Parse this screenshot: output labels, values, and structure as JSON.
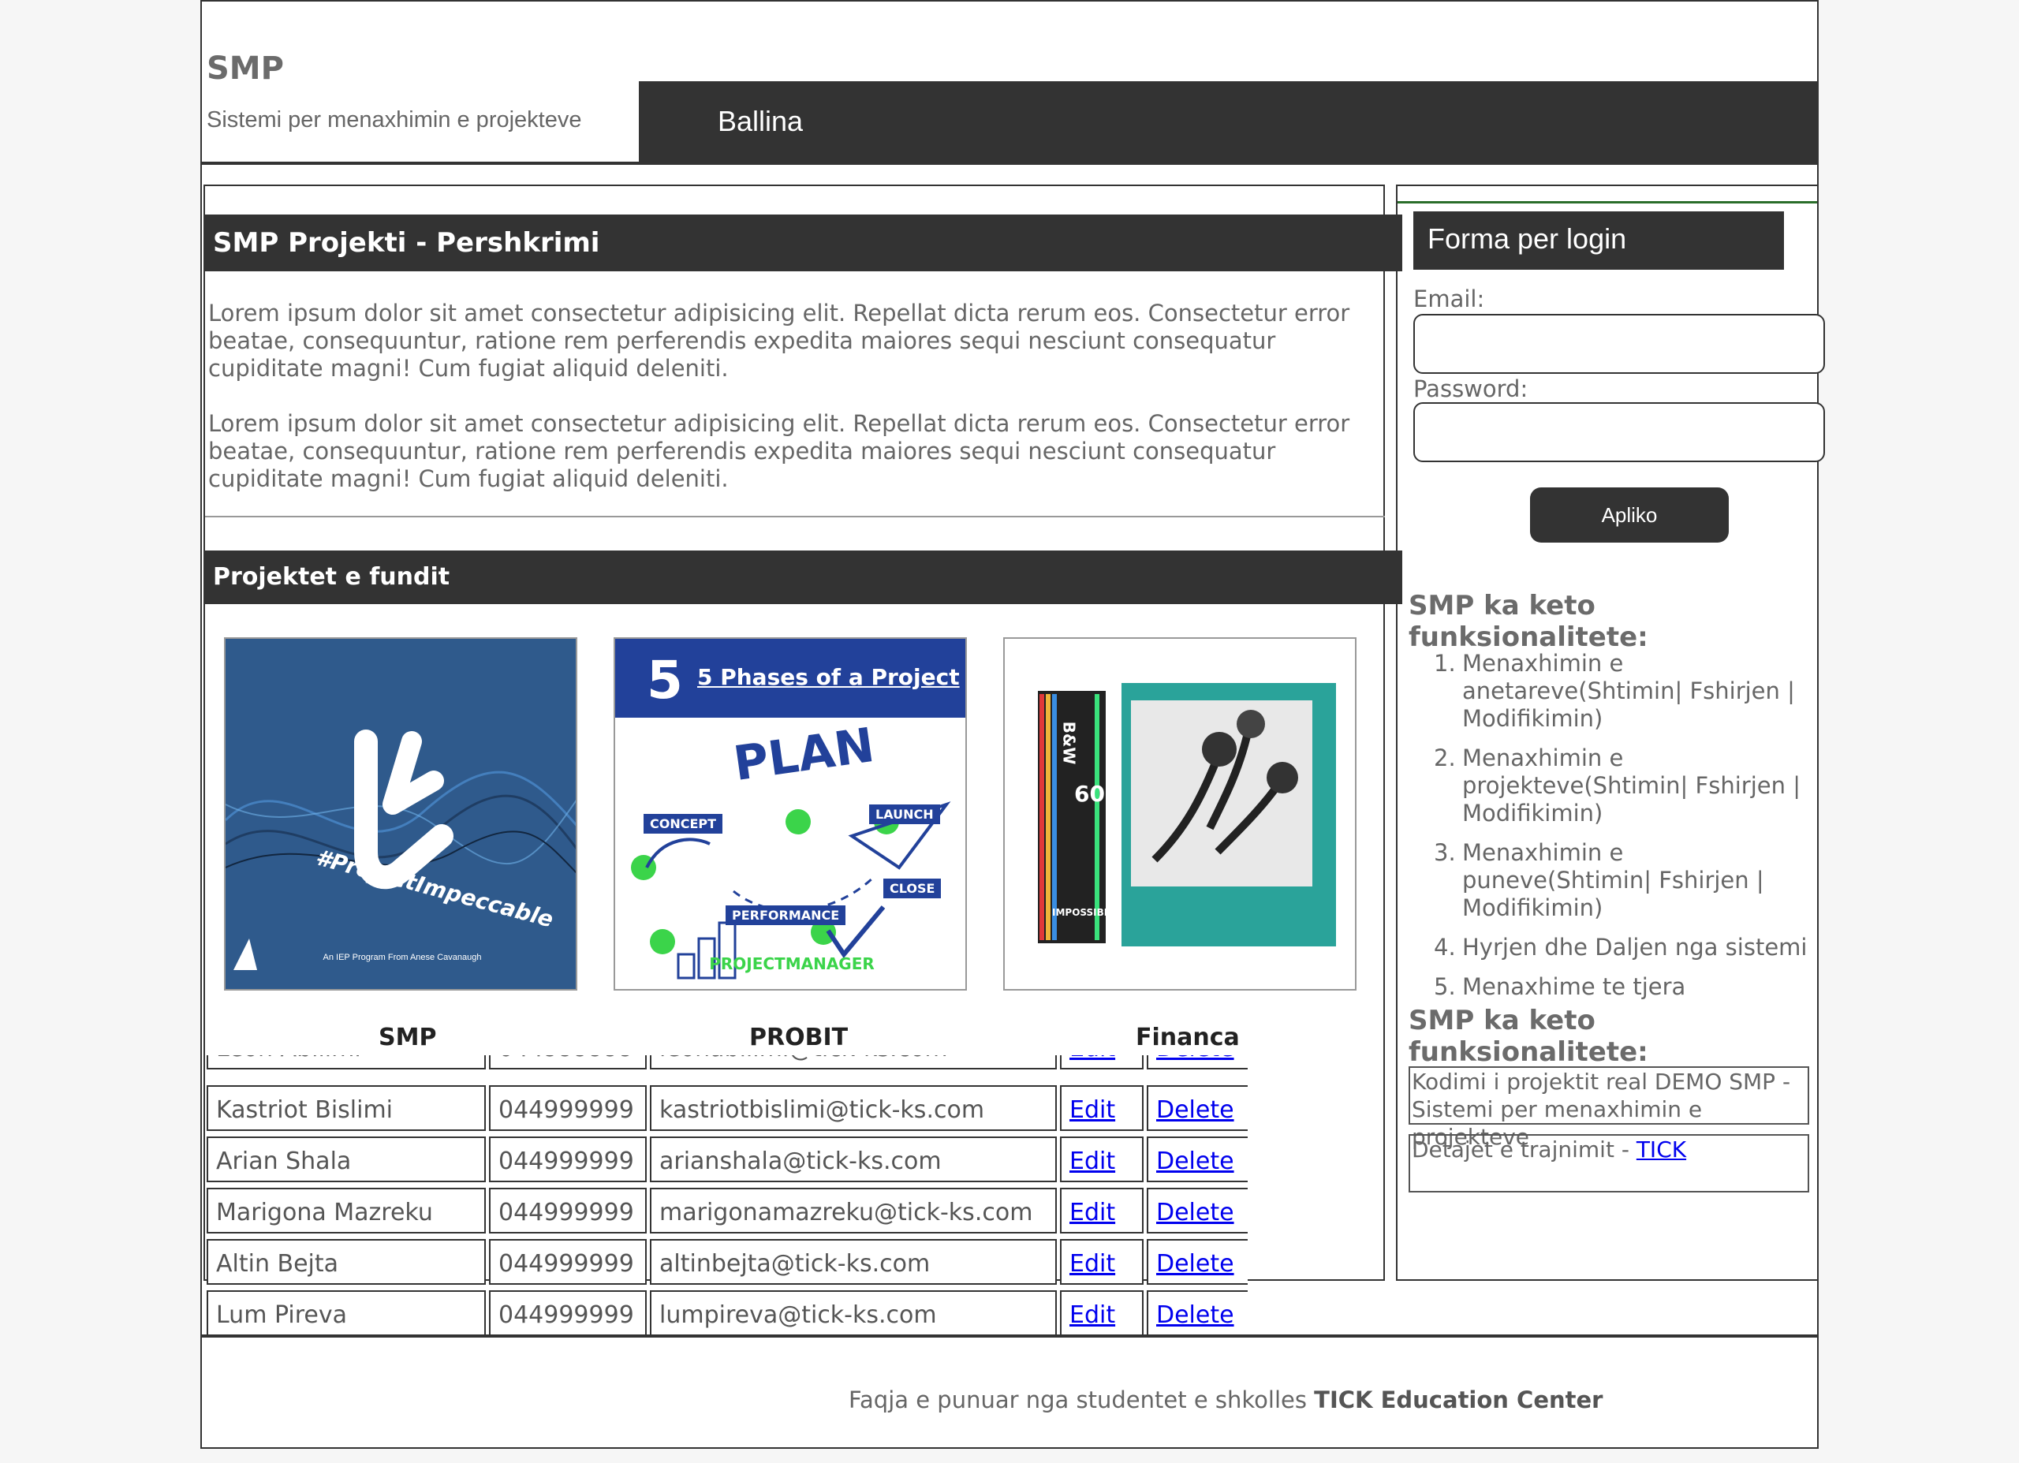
{
  "header": {
    "site_title": "SMP",
    "site_subtitle": "Sistemi per menaxhimin e projekteve",
    "nav_item": "Ballina"
  },
  "main": {
    "section_title": "SMP Projekti - Pershkrimi",
    "paragraph_1": "Lorem ipsum dolor sit amet consectetur adipisicing elit. Repellat dicta rerum eos. Consectetur error beatae, consequuntur, ratione rem perferendis expedita maiores sequi nesciunt consequatur cupiditate magni! Cum fugiat aliquid deleniti.",
    "paragraph_2": "Lorem ipsum dolor sit amet consectetur adipisicing elit. Repellat dicta rerum eos. Consectetur error beatae, consequuntur, ratione rem perferendis expedita maiores sequi nesciunt consequatur cupiditate magni! Cum fugiat aliquid deleniti.",
    "recent_title": "Projektet e fundit",
    "project_images": [
      {
        "label": "SMP",
        "image_text": "#ProjectImpeccable",
        "caption": "An IEP Program From Anese Cavanaugh"
      },
      {
        "label": "PROBIT",
        "image_title": "5 Phases of a Project",
        "phases": [
          "CONCEPT",
          "PLAN",
          "LAUNCH",
          "PERFORMANCE",
          "CLOSE"
        ],
        "brand": "PROJECTMANAGER"
      },
      {
        "label": "Financa",
        "image_text": [
          "B&W",
          "600",
          "IMPOSSIBLE"
        ]
      }
    ]
  },
  "table": {
    "edit_label": "Edit",
    "delete_label": "Delete",
    "rows": [
      {
        "name": "Leon Abilimi",
        "phone": "044999999",
        "email": "leonabilimi@tick-ks.com"
      },
      {
        "name": "Kastriot Bislimi",
        "phone": "044999999",
        "email": "kastriotbislimi@tick-ks.com"
      },
      {
        "name": "Arian Shala",
        "phone": "044999999",
        "email": "arianshala@tick-ks.com"
      },
      {
        "name": "Marigona Mazreku",
        "phone": "044999999",
        "email": "marigonamazreku@tick-ks.com"
      },
      {
        "name": "Altin Bejta",
        "phone": "044999999",
        "email": "altinbejta@tick-ks.com"
      },
      {
        "name": "Lum Pireva",
        "phone": "044999999",
        "email": "lumpireva@tick-ks.com"
      }
    ]
  },
  "sidebar": {
    "login_title": "Forma per login",
    "email_label": "Email:",
    "password_label": "Password:",
    "submit_label": "Apliko",
    "features_title": "SMP ka keto funksionalitete:",
    "features": [
      "Menaxhimin e anetareve(Shtimin| Fshirjen | Modifikimin)",
      "Menaxhimin e projekteve(Shtimin| Fshirjen | Modifikimin)",
      "Menaxhimin e puneve(Shtimin| Fshirjen | Modifikimin)",
      "Hyrjen dhe Daljen nga sistemi",
      "Menaxhime te tjera"
    ],
    "features_title_2": "SMP ka keto funksionalitete:",
    "box_1": "Kodimi i projektit real DEMO SMP - Sistemi per menaxhimin e projekteve",
    "box_2_text": "Detajet e trajnimit - ",
    "box_2_link": "TICK"
  },
  "footer": {
    "text": "Faqja e punuar nga studentet e shkolles ",
    "brand": "TICK Education Center"
  }
}
